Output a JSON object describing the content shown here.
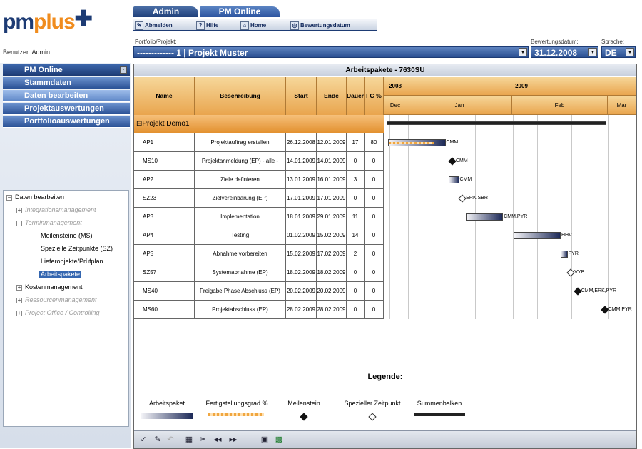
{
  "logo": {
    "pm": "pm",
    "plus": "plus"
  },
  "user_label": "Benutzer: Admin",
  "top_tabs": [
    "Admin",
    "PM Online"
  ],
  "toolbar": {
    "logout": "Abmelden",
    "help": "Hilfe",
    "home": "Home",
    "valuation_date": "Bewertungsdatum"
  },
  "portfolio": {
    "label": "Portfolio/Projekt:",
    "value": "------------- 1 | Projekt Muster"
  },
  "valuation": {
    "label": "Bewertungsdatum:",
    "value": "31.12.2008"
  },
  "language": {
    "label": "Sprache:",
    "value": "DE"
  },
  "nav": {
    "header": "PM Online",
    "items": [
      "Stammdaten",
      "Daten bearbeiten",
      "Projektauswertungen",
      "Portfolioauswertungen"
    ]
  },
  "tree": {
    "root": "Daten bearbeiten",
    "items": [
      "Integrationsmanagement",
      "Terminmanagement",
      "Meilensteine (MS)",
      "Spezielle Zeitpunkte (SZ)",
      "Lieferobjekte/Prüfplan",
      "Arbeitspakete",
      "Kostenmanagement",
      "Ressourcenmanagement",
      "Project Office / Controlling"
    ]
  },
  "main": {
    "title": "Arbeitspakete - 7630SU"
  },
  "columns": [
    "Name",
    "Beschreibung",
    "Start",
    "Ende",
    "Dauer",
    "FG %"
  ],
  "timeline": {
    "years": [
      "2008",
      "2009"
    ],
    "months": [
      "Dec",
      "Jan",
      "Feb",
      "Mar"
    ]
  },
  "group": "⊟Projekt Demo1",
  "rows": [
    {
      "name": "AP1",
      "desc": "Projektauftrag erstellen",
      "start": "26.12.2008",
      "end": "12.01.2009",
      "dur": "17",
      "fg": "80",
      "label": "CMM"
    },
    {
      "name": "MS10",
      "desc": "Projektanmeldung (EP) - alle -",
      "start": "14.01.2009",
      "end": "14.01.2009",
      "dur": "0",
      "fg": "0",
      "label": "CMM"
    },
    {
      "name": "AP2",
      "desc": "Ziele definieren",
      "start": "13.01.2009",
      "end": "16.01.2009",
      "dur": "3",
      "fg": "0",
      "label": "CMM"
    },
    {
      "name": "SZ23",
      "desc": "Zielvereinbarung (EP)",
      "start": "17.01.2009",
      "end": "17.01.2009",
      "dur": "0",
      "fg": "0",
      "label": "ERK,SBR"
    },
    {
      "name": "AP3",
      "desc": "Implementation",
      "start": "18.01.2009",
      "end": "29.01.2009",
      "dur": "11",
      "fg": "0",
      "label": "CMM,PYR"
    },
    {
      "name": "AP4",
      "desc": "Testing",
      "start": "01.02.2009",
      "end": "15.02.2009",
      "dur": "14",
      "fg": "0",
      "label": "HHV"
    },
    {
      "name": "AP5",
      "desc": "Abnahme vorbereiten",
      "start": "15.02.2009",
      "end": "17.02.2009",
      "dur": "2",
      "fg": "0",
      "label": "PYR"
    },
    {
      "name": "SZ57",
      "desc": "Systemabnahme (EP)",
      "start": "18.02.2009",
      "end": "18.02.2009",
      "dur": "0",
      "fg": "0",
      "label": "VYB"
    },
    {
      "name": "MS40",
      "desc": "Freigabe Phase Abschluss (EP)",
      "start": "20.02.2009",
      "end": "20.02.2009",
      "dur": "0",
      "fg": "0",
      "label": "CMM,ERK,PYR"
    },
    {
      "name": "MS60",
      "desc": "Projektabschluss (EP)",
      "start": "28.02.2009",
      "end": "28.02.2009",
      "dur": "0",
      "fg": "0",
      "label": "CMM,PYR"
    }
  ],
  "legend": {
    "title": "Legende:",
    "items": [
      "Arbeitspaket",
      "Fertigstellungsgrad %",
      "Meilenstein",
      "Spezieller Zeitpunkt",
      "Summenbalken"
    ]
  }
}
